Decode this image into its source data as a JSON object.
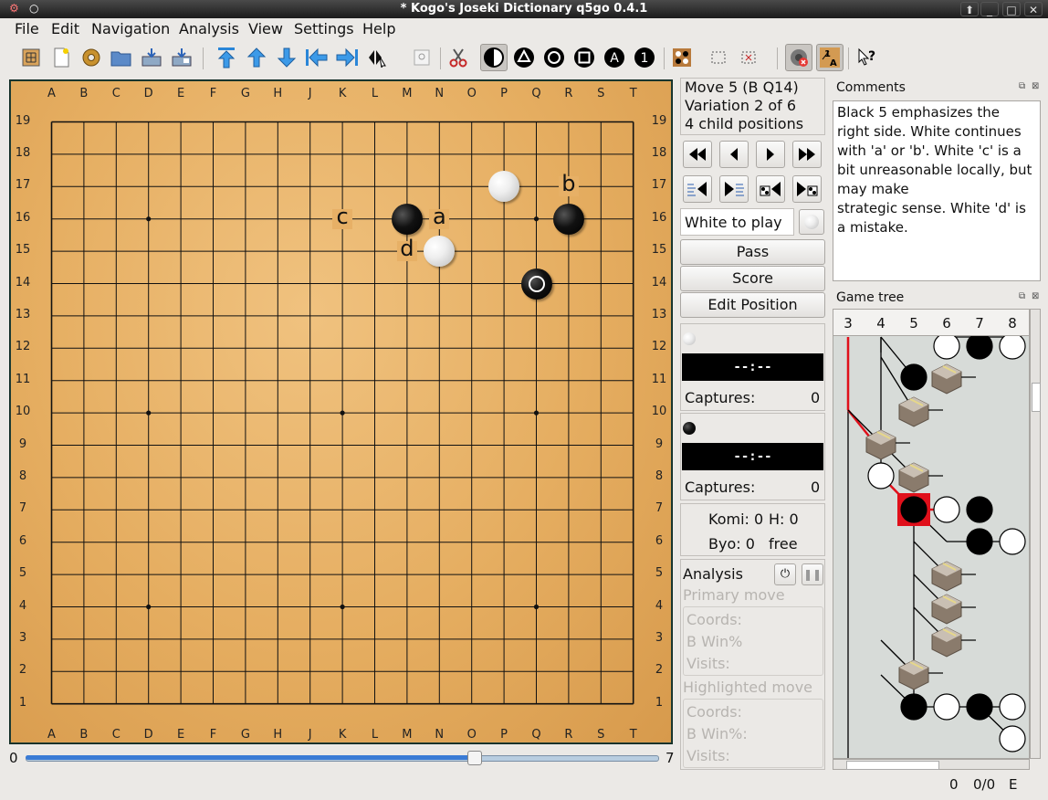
{
  "window": {
    "title": "* Kogo's Joseki Dictionary   q5go 0.4.1"
  },
  "menu": [
    {
      "label": "File"
    },
    {
      "label": "Edit"
    },
    {
      "label": "Navigation"
    },
    {
      "label": "Analysis"
    },
    {
      "label": "View"
    },
    {
      "label": "Settings"
    },
    {
      "label": "Help"
    }
  ],
  "toolbar_icons": [
    "new-board-icon",
    "new-file-icon",
    "donut-icon",
    "open-folder-icon",
    "save-icon",
    "save-as-icon",
    "first-move-icon",
    "previous-move-icon",
    "next-move-icon",
    "previous-variation-icon",
    "next-variation-icon",
    "navigation-tool-icon",
    "zoom-icon",
    "cut-icon",
    "black-white-icon",
    "triangle-mark-icon",
    "circle-mark-icon",
    "square-mark-icon",
    "letter-mark-icon",
    "number-mark-icon",
    "edit-position-icon",
    "select-rectangle-icon",
    "delete-rectangle-icon",
    "sound-off-icon",
    "coordinates-icon",
    "whats-this-icon"
  ],
  "board": {
    "columns": [
      "A",
      "B",
      "C",
      "D",
      "E",
      "F",
      "G",
      "H",
      "J",
      "K",
      "L",
      "M",
      "N",
      "O",
      "P",
      "Q",
      "R",
      "S",
      "T"
    ],
    "rows": [
      "19",
      "18",
      "17",
      "16",
      "15",
      "14",
      "13",
      "12",
      "11",
      "10",
      "9",
      "8",
      "7",
      "6",
      "5",
      "4",
      "3",
      "2",
      "1"
    ],
    "stones": [
      {
        "color": "white",
        "point": "P17"
      },
      {
        "color": "black",
        "point": "M16"
      },
      {
        "color": "black",
        "point": "R16"
      },
      {
        "color": "white",
        "point": "N15"
      },
      {
        "color": "black",
        "point": "Q14",
        "last_move": true
      }
    ],
    "labels": [
      {
        "text": "b",
        "point": "R17"
      },
      {
        "text": "c",
        "point": "K16"
      },
      {
        "text": "a",
        "point": "N16"
      },
      {
        "text": "d",
        "point": "M15"
      }
    ],
    "hoshi": [
      "D16",
      "K16",
      "Q16",
      "D10",
      "K10",
      "Q10",
      "D4",
      "K4",
      "Q4"
    ]
  },
  "slider": {
    "min": "0",
    "max": "7",
    "value": 5
  },
  "move_info": {
    "line1": "Move 5 (B Q14)",
    "line2": "Variation 2 of 6",
    "line3": "4 child positions"
  },
  "to_play": "White to play",
  "buttons": {
    "pass": "Pass",
    "score": "Score",
    "edit_position": "Edit Position"
  },
  "white_player": {
    "clock": "--:--",
    "captures_label": "Captures:",
    "captures": "0"
  },
  "black_player": {
    "clock": "--:--",
    "captures_label": "Captures:",
    "captures": "0"
  },
  "game_info": {
    "komi": "Komi:  0",
    "handicap": "H: 0",
    "byo": "Byo:  0",
    "time_system": "free"
  },
  "analysis": {
    "title": "Analysis",
    "primary": "Primary move",
    "highlighted": "Highlighted move",
    "coords": "Coords:",
    "bwin": "B Win%",
    "bwin2": "B Win%:",
    "visits": "Visits:"
  },
  "comments": {
    "title": "Comments",
    "text": "Black 5 emphasizes the right side. White continues with 'a' or 'b'. White 'c' is a bit unreasonable locally, but may make\nstrategic sense. White 'd' is a mistake."
  },
  "game_tree": {
    "title": "Game tree",
    "columns": [
      "3",
      "4",
      "5",
      "6",
      "7",
      "8"
    ]
  },
  "status": {
    "move": "0",
    "score": "0/0",
    "mode": "E"
  },
  "colors": {
    "board_wood": "#e5ad60",
    "tree_highlight": "#e0101b",
    "tree_bg": "#d7dbd8"
  }
}
